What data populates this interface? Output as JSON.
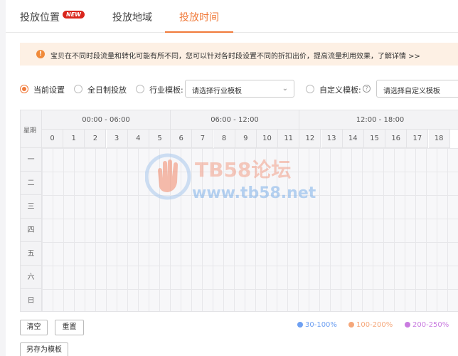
{
  "tabs": [
    {
      "label": "投放位置",
      "badge": "NEW"
    },
    {
      "label": "投放地域"
    },
    {
      "label": "投放时间",
      "active": true
    }
  ],
  "notice": {
    "text": "宝贝在不同时段流量和转化可能有所不同，您可以针对各时段设置不同的折扣出价，提高流量利用效果，",
    "link": "了解详情 >>"
  },
  "options": {
    "current": "当前设置",
    "allday": "全日制投放",
    "industry_label": "行业模板:",
    "industry_select": "请选择行业模板",
    "custom_label": "自定义模板:",
    "custom_select": "请选择自定义模板"
  },
  "grid": {
    "week_label": "星期",
    "ranges": [
      "00:00 - 06:00",
      "06:00 - 12:00",
      "12:00 - 18:00"
    ],
    "hours": [
      "0",
      "1",
      "2",
      "3",
      "4",
      "5",
      "6",
      "7",
      "8",
      "9",
      "10",
      "11",
      "12",
      "13",
      "14",
      "15",
      "16",
      "17",
      "18"
    ],
    "days": [
      "一",
      "二",
      "三",
      "四",
      "五",
      "六",
      "日"
    ]
  },
  "buttons": {
    "clear": "清空",
    "reset": "重置",
    "save_template": "另存为模板"
  },
  "legend": [
    {
      "label": "30-100%",
      "color": "#6ea0f2"
    },
    {
      "label": "100-200%",
      "color": "#f5a77a"
    },
    {
      "label": "200-250%",
      "color": "#c97be0"
    }
  ],
  "watermark": {
    "title": "TB58论坛",
    "url": "www.tb58.net"
  },
  "colors": {
    "accent": "#f07a3a",
    "badge": "#d9261c"
  }
}
